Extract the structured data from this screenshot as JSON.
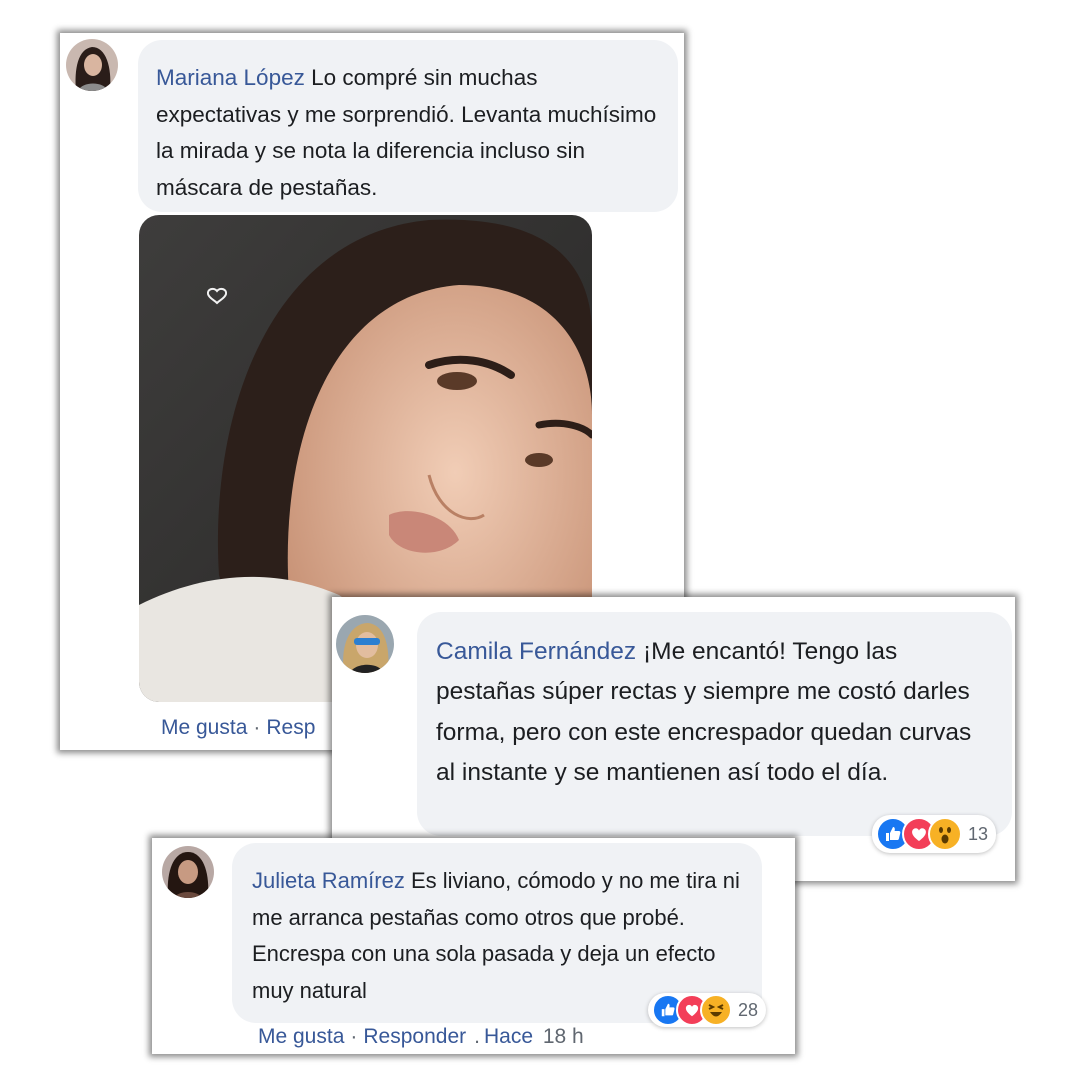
{
  "comments": [
    {
      "name": "Mariana López",
      "text": "Lo compré sin muchas expectativas y me sorprendió. Levanta muchísimo la mirada y se nota la diferencia incluso sin máscara de pestañas.",
      "actions": {
        "like": "Me gusta",
        "reply": "Resp"
      }
    },
    {
      "name": "Camila Fernández",
      "text": "¡Me encantó! Tengo las pestañas súper rectas y siempre me costó darles forma, pero con este encrespador quedan curvas al instante y se mantienen así todo el día.",
      "reactions": {
        "icons": [
          "like-icon",
          "love-icon",
          "wow-icon"
        ],
        "count": "13"
      }
    },
    {
      "name": "Julieta Ramírez",
      "text": "Es liviano, cómodo y no me tira ni me arranca pestañas como otros que probé. Encrespa con una sola pasada y deja un efecto muy natural",
      "reactions": {
        "icons": [
          "like-icon",
          "love-icon",
          "haha-icon"
        ],
        "count": "28"
      },
      "actions": {
        "like": "Me gusta",
        "reply": "Responder",
        "time_label": "Hace",
        "time_value": "18 h"
      }
    }
  ],
  "colors": {
    "name": "#385898",
    "bubble": "#f0f2f5",
    "like": "#1877f2",
    "love": "#f33e58",
    "wow": "#f7b125"
  }
}
